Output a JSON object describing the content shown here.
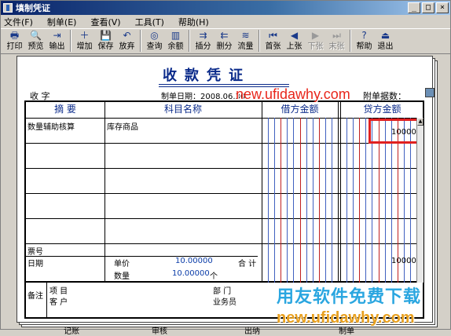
{
  "window": {
    "title": "填制凭证",
    "min": "_",
    "max": "□",
    "close": "×"
  },
  "menu": [
    "文件(F)",
    "制单(E)",
    "查看(V)",
    "工具(T)",
    "帮助(H)"
  ],
  "toolbar": [
    {
      "label": "打印",
      "icon": "printer-icon"
    },
    {
      "label": "预览",
      "icon": "preview-icon"
    },
    {
      "label": "输出",
      "icon": "export-icon"
    },
    {
      "sep": true
    },
    {
      "label": "增加",
      "icon": "add-icon"
    },
    {
      "label": "保存",
      "icon": "save-icon"
    },
    {
      "label": "放弃",
      "icon": "undo-icon"
    },
    {
      "sep": true
    },
    {
      "label": "查询",
      "icon": "binoculars-icon"
    },
    {
      "label": "余额",
      "icon": "balance-chart-icon"
    },
    {
      "sep": true
    },
    {
      "label": "插分",
      "icon": "insert-row-icon"
    },
    {
      "label": "删分",
      "icon": "delete-row-icon"
    },
    {
      "label": "流量",
      "icon": "cashflow-icon"
    },
    {
      "sep": true
    },
    {
      "label": "首张",
      "icon": "first-icon"
    },
    {
      "label": "上张",
      "icon": "prev-icon"
    },
    {
      "label": "下张",
      "icon": "next-icon",
      "disabled": true
    },
    {
      "label": "末张",
      "icon": "last-icon",
      "disabled": true
    },
    {
      "sep": true
    },
    {
      "label": "帮助",
      "icon": "help-icon"
    },
    {
      "label": "退出",
      "icon": "exit-icon"
    }
  ],
  "voucher": {
    "title": "收款凭证",
    "type": "收  字",
    "date": "制单日期：2008.06.30",
    "attachment": "附单据数：",
    "headers": {
      "summary": "摘  要",
      "account": "科目名称",
      "debit": "借方金额",
      "credit": "贷方金额"
    },
    "row1": {
      "summary": "数量辅助核算",
      "account": "库存商品",
      "credit": "10000"
    },
    "lower": {
      "ticket": "票号",
      "date": "日期",
      "unit_price_label": "单价",
      "unit_price": "10.00000",
      "qty_label": "数量",
      "qty": "10.00000",
      "qty_unit": "个",
      "total_label": "合 计",
      "total_credit": "10000",
      "remark": "备注",
      "project": "项  目",
      "customer": "客  户",
      "dept": "部  门",
      "staff": "业务员"
    },
    "footer": {
      "bookkeep": "记账",
      "audit": "审核",
      "cashier": "出纳",
      "maker": "制单"
    }
  },
  "watermarks": {
    "url_top": "new.ufidawhy.com",
    "cn": "用友软件免费下载",
    "url_bottom": "new.ufidawhy.com"
  }
}
